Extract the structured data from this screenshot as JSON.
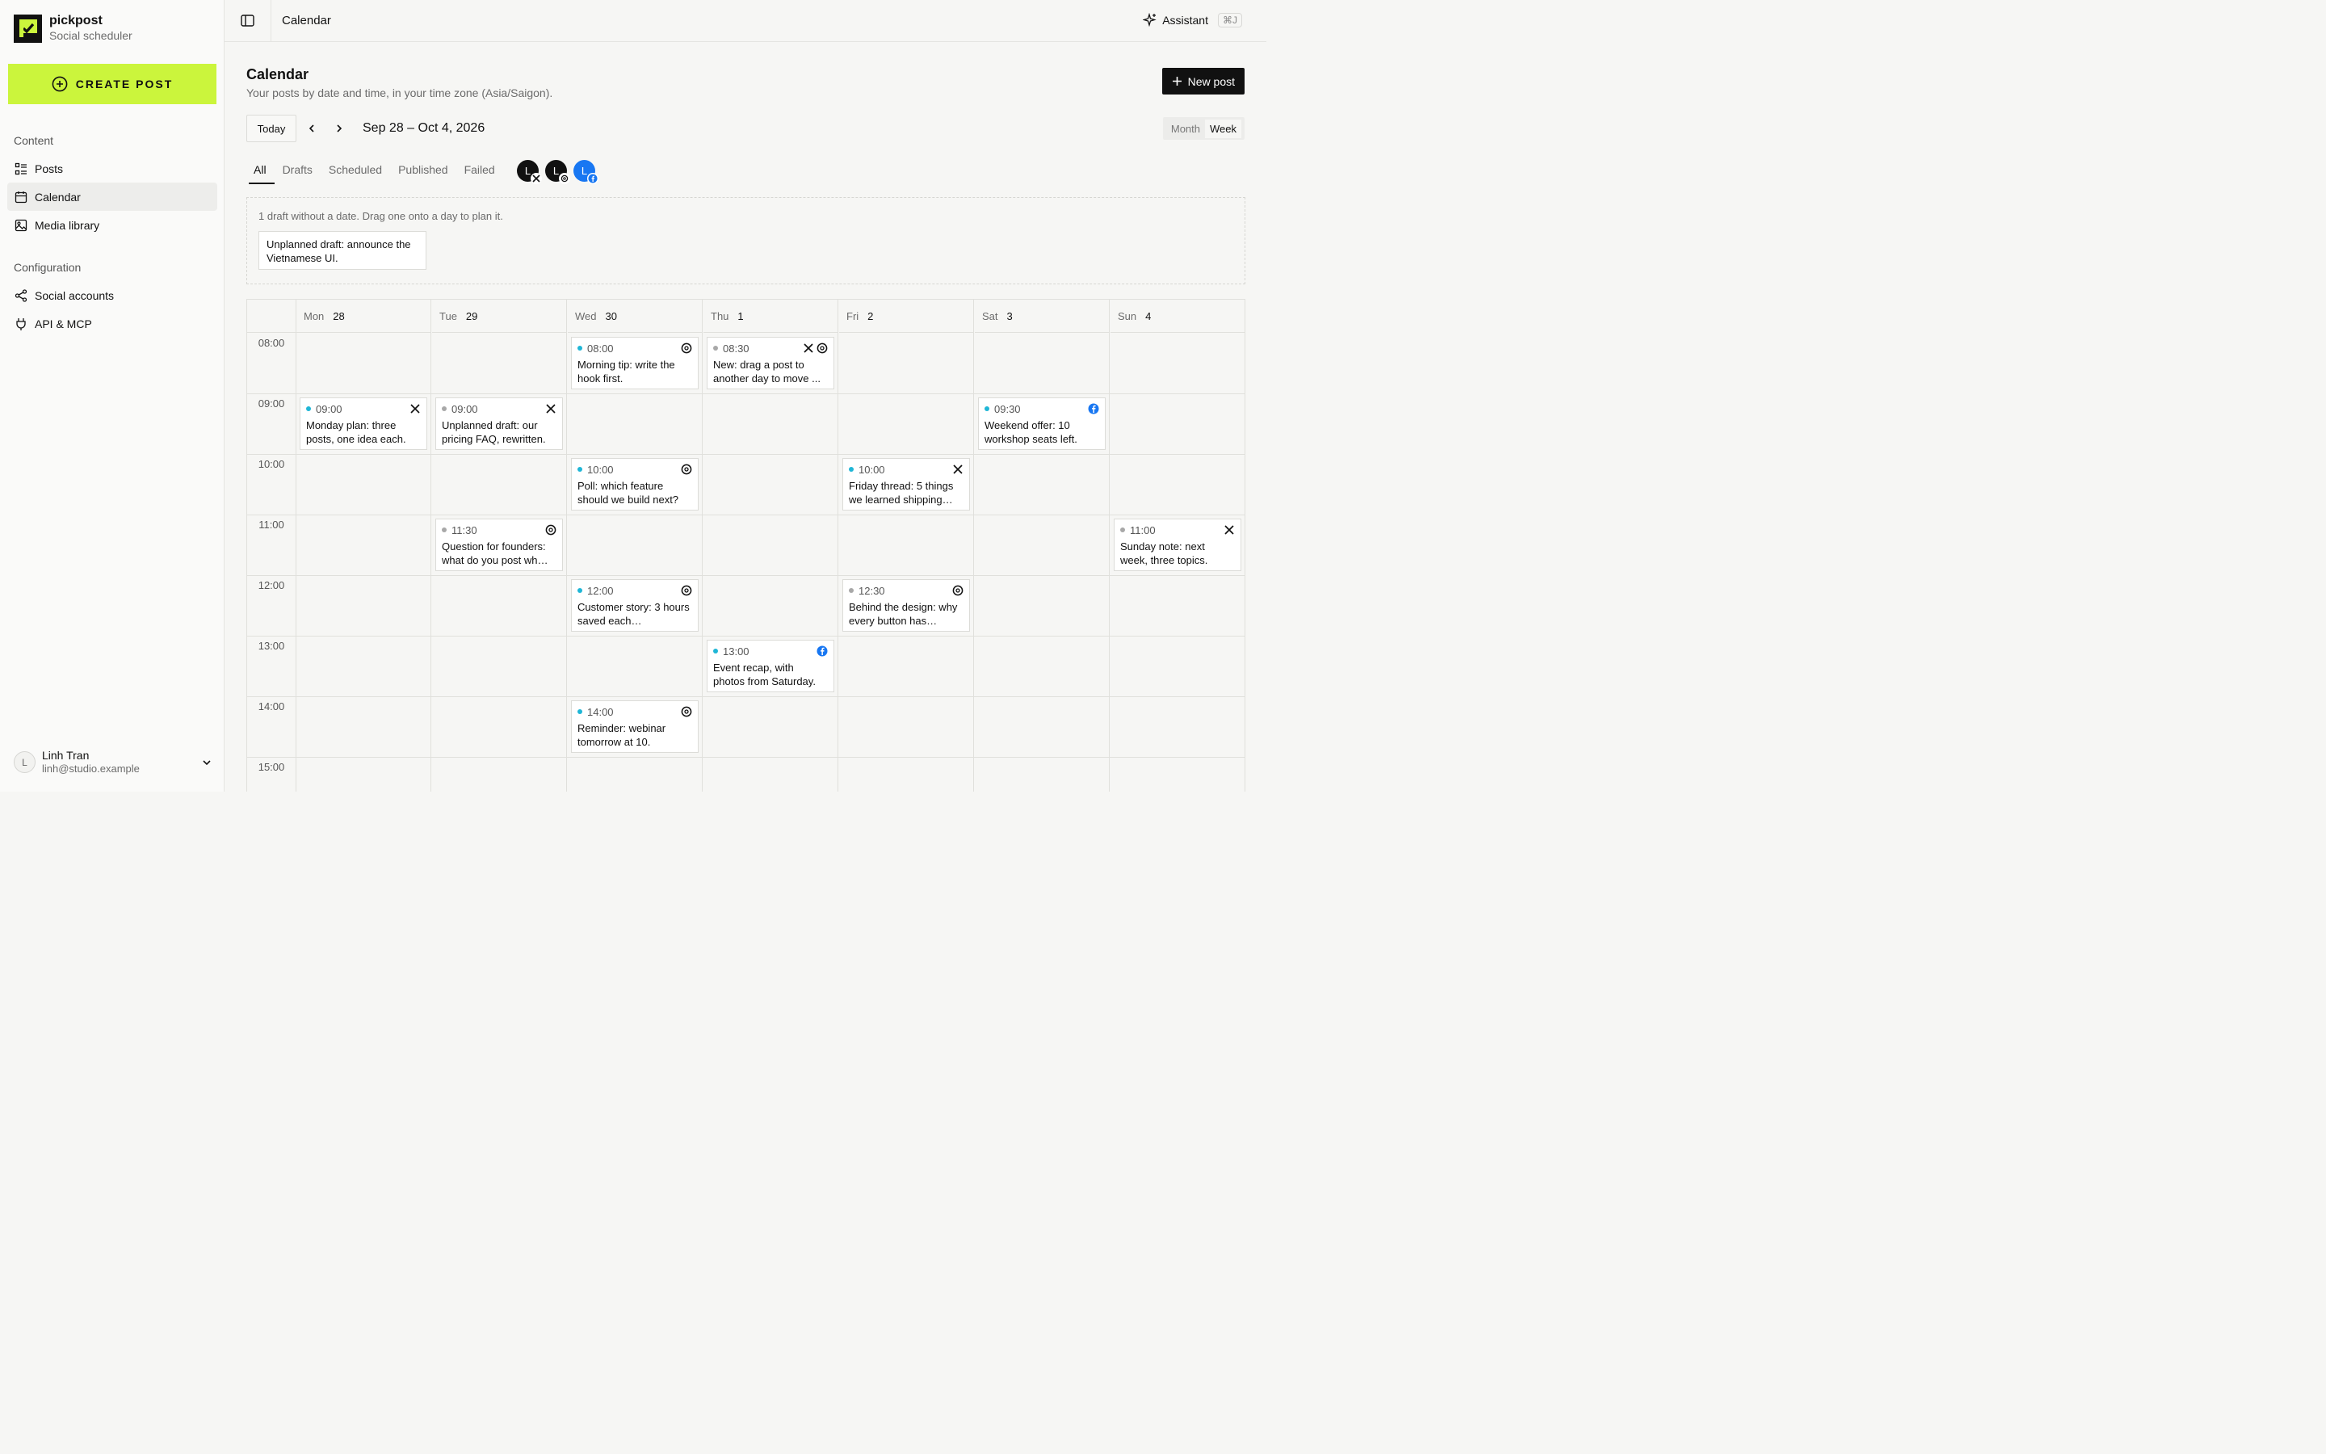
{
  "brand": {
    "name": "pickpost",
    "subtitle": "Social scheduler"
  },
  "sidebar": {
    "create_label": "CREATE POST",
    "sections": [
      {
        "label": "Content",
        "items": [
          {
            "label": "Posts",
            "icon": "list-icon"
          },
          {
            "label": "Calendar",
            "icon": "calendar-icon",
            "active": true
          },
          {
            "label": "Media library",
            "icon": "image-icon"
          }
        ]
      },
      {
        "label": "Configuration",
        "items": [
          {
            "label": "Social accounts",
            "icon": "share-icon"
          },
          {
            "label": "API & MCP",
            "icon": "plug-icon"
          }
        ]
      }
    ],
    "user": {
      "initial": "L",
      "name": "Linh Tran",
      "email": "linh@studio.example"
    }
  },
  "topbar": {
    "title": "Calendar",
    "assistant_label": "Assistant",
    "assistant_shortcut": "⌘J"
  },
  "page": {
    "title": "Calendar",
    "subtitle": "Your posts by date and time, in your time zone (Asia/Saigon).",
    "new_post_label": "New post",
    "today_label": "Today",
    "range": "Sep 28 – Oct 4, 2026",
    "views": [
      "Month",
      "Week"
    ],
    "active_view": "Week",
    "tabs": [
      "All",
      "Drafts",
      "Scheduled",
      "Published",
      "Failed"
    ],
    "active_tab": "All",
    "accounts": [
      {
        "initial": "L",
        "network": "x",
        "color": "#111111"
      },
      {
        "initial": "L",
        "network": "threads",
        "color": "#111111"
      },
      {
        "initial": "L",
        "network": "facebook",
        "color": "#1877f2"
      }
    ]
  },
  "unplanned": {
    "message": "1 draft without a date. Drag one onto a day to plan it.",
    "drafts": [
      "Unplanned draft: announce the Vietnamese UI."
    ]
  },
  "calendar": {
    "days": [
      {
        "dow": "Mon",
        "date": "28"
      },
      {
        "dow": "Tue",
        "date": "29"
      },
      {
        "dow": "Wed",
        "date": "30"
      },
      {
        "dow": "Thu",
        "date": "1"
      },
      {
        "dow": "Fri",
        "date": "2"
      },
      {
        "dow": "Sat",
        "date": "3"
      },
      {
        "dow": "Sun",
        "date": "4"
      }
    ],
    "hours": [
      "08:00",
      "09:00",
      "10:00",
      "11:00",
      "12:00",
      "13:00",
      "14:00",
      "15:00"
    ],
    "status_colors": {
      "scheduled": "#1fb6d6",
      "draft": "#a8a8a8"
    },
    "events": [
      {
        "day": 2,
        "time": "08:00",
        "status": "scheduled",
        "networks": [
          "threads"
        ],
        "text": "Morning tip: write the hook first."
      },
      {
        "day": 3,
        "time": "08:30",
        "status": "draft",
        "networks": [
          "x",
          "threads"
        ],
        "text": "New: drag a post to another day to move ..."
      },
      {
        "day": 0,
        "time": "09:00",
        "status": "scheduled",
        "networks": [
          "x"
        ],
        "text": "Monday plan: three posts, one idea each."
      },
      {
        "day": 1,
        "time": "09:00",
        "status": "draft",
        "networks": [
          "x"
        ],
        "text": "Unplanned draft: our pricing FAQ, rewritten."
      },
      {
        "day": 5,
        "time": "09:30",
        "status": "scheduled",
        "networks": [
          "facebook"
        ],
        "text": "Weekend offer: 10 workshop seats left."
      },
      {
        "day": 2,
        "time": "10:00",
        "status": "scheduled",
        "networks": [
          "threads"
        ],
        "text": "Poll: which feature should we build next?"
      },
      {
        "day": 4,
        "time": "10:00",
        "status": "scheduled",
        "networks": [
          "x"
        ],
        "text": "Friday thread: 5 things we learned shipping…"
      },
      {
        "day": 1,
        "time": "11:30",
        "status": "draft",
        "networks": [
          "threads"
        ],
        "text": "Question for founders: what do you post wh…"
      },
      {
        "day": 6,
        "time": "11:00",
        "status": "draft",
        "networks": [
          "x"
        ],
        "text": "Sunday note: next week, three topics."
      },
      {
        "day": 2,
        "time": "12:00",
        "status": "scheduled",
        "networks": [
          "threads"
        ],
        "text": "Customer story: 3 hours saved each…"
      },
      {
        "day": 4,
        "time": "12:30",
        "status": "draft",
        "networks": [
          "threads"
        ],
        "text": "Behind the design: why every button has…"
      },
      {
        "day": 3,
        "time": "13:00",
        "status": "scheduled",
        "networks": [
          "facebook"
        ],
        "text": "Event recap, with photos from Saturday."
      },
      {
        "day": 2,
        "time": "14:00",
        "status": "scheduled",
        "networks": [
          "threads"
        ],
        "text": "Reminder: webinar tomorrow at 10."
      }
    ]
  }
}
